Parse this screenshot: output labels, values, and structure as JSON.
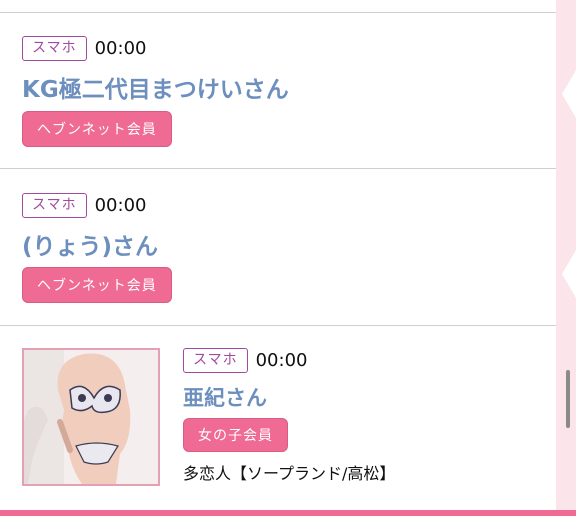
{
  "items": [
    {
      "badge": "スマホ",
      "time": "00:00",
      "name": "KG極二代目まつけいさん",
      "member": "ヘブンネット会員"
    },
    {
      "badge": "スマホ",
      "time": "00:00",
      "name": "(りょう)さん",
      "member": "ヘブンネット会員"
    },
    {
      "badge": "スマホ",
      "time": "00:00",
      "name": "亜紀さん",
      "member": "女の子会員",
      "shop": "多恋人【ソープランド/高松】"
    }
  ],
  "colors": {
    "name": "#6d8fbe",
    "badge": "#a14aa0",
    "member_button": "#f06b93",
    "accent_strip": "#fbe4ea"
  }
}
